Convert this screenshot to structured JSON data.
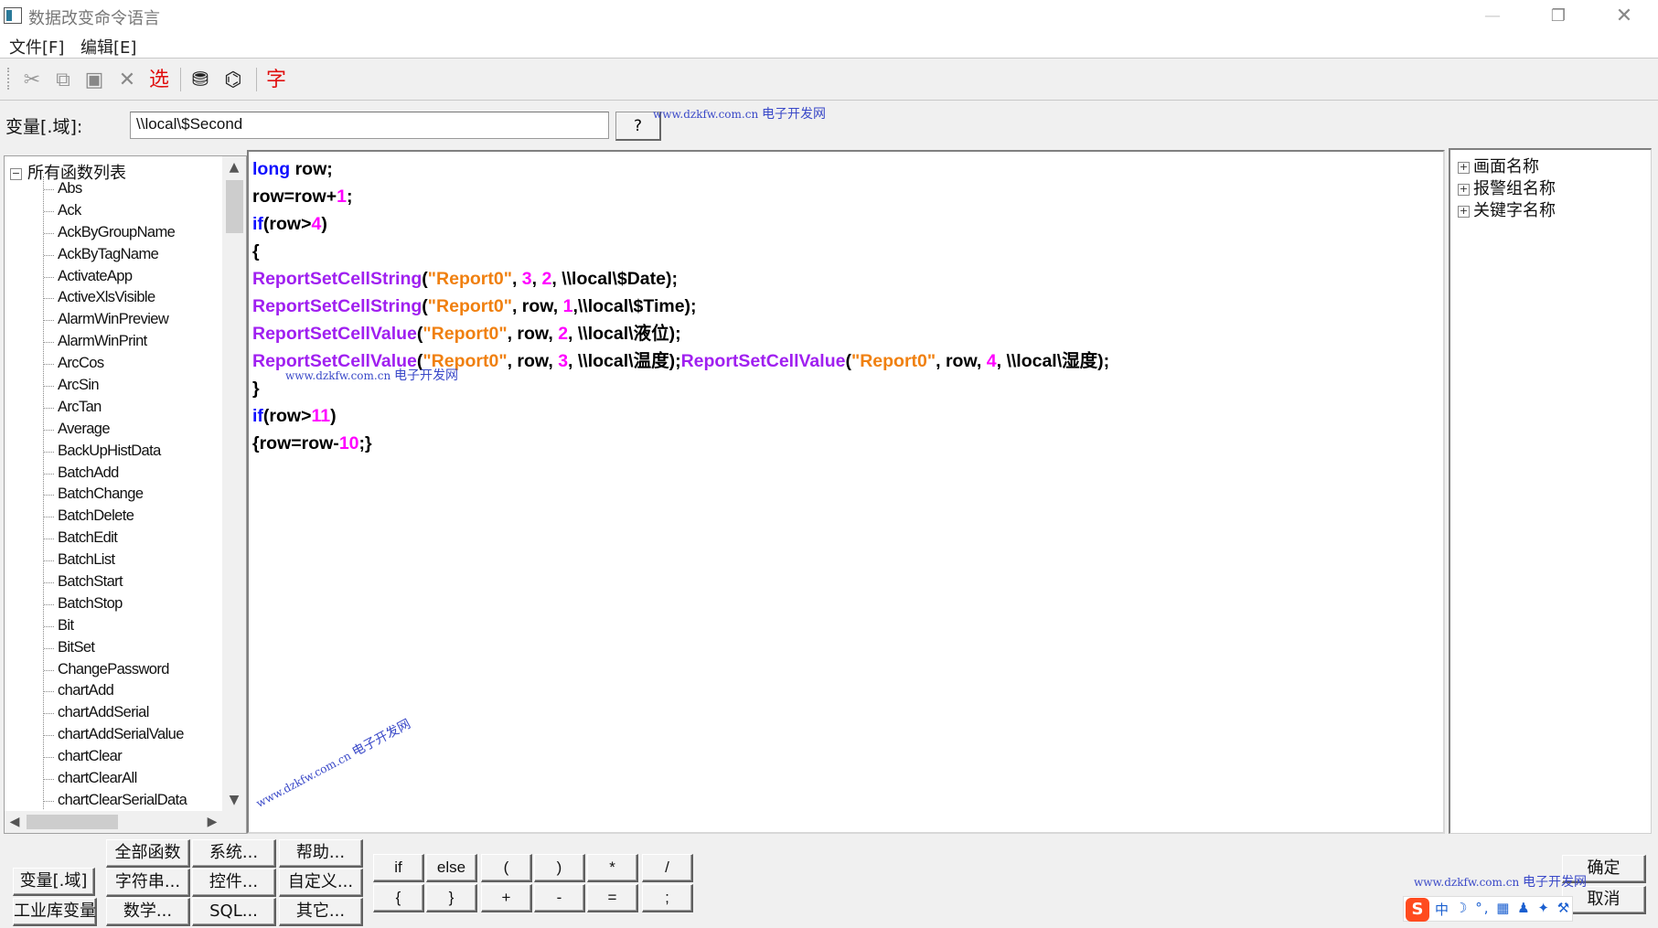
{
  "window": {
    "title": "数据改变命令语言",
    "min_glyph": "—",
    "max_glyph": "❐",
    "close_glyph": "✕"
  },
  "menu": {
    "file": "文件[F]",
    "edit": "编辑[E]"
  },
  "toolbar": {
    "cut": "✂",
    "copy": "⧉",
    "paste": "▣",
    "delete": "✕",
    "select": "选",
    "find": "⛃",
    "replace": "⌬",
    "font": "字"
  },
  "variable": {
    "label": "变量[.域]:",
    "value": "\\\\local\\$Second",
    "help_label": "?"
  },
  "watermark": {
    "url": "www.dzkfw.com.cn",
    "name": "电子开发网"
  },
  "function_tree": {
    "root_label": "所有函数列表",
    "root_toggle": "−",
    "items": [
      "Abs",
      "Ack",
      "AckByGroupName",
      "AckByTagName",
      "ActivateApp",
      "ActiveXlsVisible",
      "AlarmWinPreview",
      "AlarmWinPrint",
      "ArcCos",
      "ArcSin",
      "ArcTan",
      "Average",
      "BackUpHistData",
      "BatchAdd",
      "BatchChange",
      "BatchDelete",
      "BatchEdit",
      "BatchList",
      "BatchStart",
      "BatchStop",
      "Bit",
      "BitSet",
      "ChangePassword",
      "chartAdd",
      "chartAddSerial",
      "chartAddSerialValue",
      "chartClear",
      "chartClearAll",
      "chartClearSerialData"
    ],
    "scroll": {
      "up": "▲",
      "down": "▼",
      "left": "◀",
      "right": "▶"
    }
  },
  "name_tree": {
    "items": [
      {
        "toggle": "+",
        "label": "画面名称"
      },
      {
        "toggle": "+",
        "label": "报警组名称"
      },
      {
        "toggle": "+",
        "label": "关键字名称"
      }
    ]
  },
  "code": {
    "l1": {
      "kw": "long",
      "rest": " row;"
    },
    "l2": {
      "a": "row=row+",
      "n": "1",
      "b": ";"
    },
    "l3": {
      "kw": "if",
      "a": "(row>",
      "n": "4",
      "b": ")"
    },
    "l4": "{",
    "l5": {
      "fn": "ReportSetCellString",
      "p": "(",
      "s": "\"Report0\"",
      "c1": ", ",
      "n1": "3",
      "c2": ", ",
      "n2": "2",
      "r": ", \\\\local\\$Date);"
    },
    "l6": {
      "fn": "ReportSetCellString",
      "p": "(",
      "s": "\"Report0\"",
      "c1": ", row, ",
      "n1": "1",
      "r": ",\\\\local\\$Time);"
    },
    "l7": {
      "fn": "ReportSetCellValue",
      "p": "(",
      "s": "\"Report0\"",
      "c1": ", row, ",
      "n1": "2",
      "r": ", \\\\local\\液位);"
    },
    "l8": {
      "fn": "ReportSetCellValue",
      "p": "(",
      "s": "\"Report0\"",
      "c1": ", row, ",
      "n1": "3",
      "m": ", \\\\local\\温度);",
      "fn2": "ReportSetCellValue",
      "p2": "(",
      "s2": "\"Report0\"",
      "c2": ", row, ",
      "n2": "4",
      "r": ", \\\\local\\湿度);"
    },
    "l9": "}",
    "l10": {
      "kw": "if",
      "a": "(row>",
      "n": "11",
      "b": ")"
    },
    "l11": {
      "a": "{row=row-",
      "n": "10",
      "b": ";}"
    }
  },
  "buttons": {
    "variable": "变量[.域]",
    "tag_var": "工业库变量",
    "all_funcs": "全部函数",
    "system": "系统...",
    "help": "帮助...",
    "string": "字符串...",
    "control": "控件...",
    "custom": "自定义...",
    "math": "数学...",
    "sql": "SQL...",
    "other": "其它...",
    "ok": "确定",
    "cancel": "取消"
  },
  "symbols": {
    "if": "if",
    "else": "else",
    "lparen": "(",
    "rparen": ")",
    "mul": "*",
    "div": "/",
    "lbrace": "{",
    "rbrace": "}",
    "plus": "+",
    "minus": "-",
    "eq": "=",
    "semi": ";"
  },
  "ime": {
    "logo": "S",
    "mode": "中",
    "icons": "☽ °, ▦ ♟ ✦ ⚒"
  }
}
